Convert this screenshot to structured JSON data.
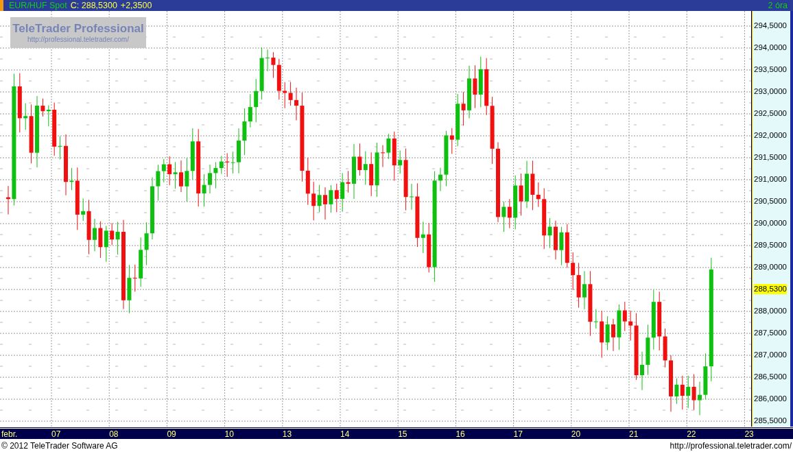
{
  "header": {
    "symbol": "EUR/HUF Spot",
    "close": "C: 288,5300",
    "change": "+2,3500",
    "interval": "2 óra"
  },
  "logo": {
    "title": "TeleTrader Professional",
    "url": "http://professional.teletrader.com/"
  },
  "price_axis": [
    {
      "label": "294,5000",
      "kind": "tick"
    },
    {
      "label": "294,0000",
      "kind": "tick"
    },
    {
      "label": "293,5000",
      "kind": "tick"
    },
    {
      "label": "293,0000",
      "kind": "tick"
    },
    {
      "label": "292,5000",
      "kind": "tick"
    },
    {
      "label": "292,0000",
      "kind": "tick"
    },
    {
      "label": "291,5000",
      "kind": "tick"
    },
    {
      "label": "291,0000",
      "kind": "tick"
    },
    {
      "label": "290,5000",
      "kind": "tick"
    },
    {
      "label": "290,0000",
      "kind": "tick"
    },
    {
      "label": "289,5000",
      "kind": "tick"
    },
    {
      "label": "289,0000",
      "kind": "tick"
    },
    {
      "label": "288,5300",
      "kind": "current"
    },
    {
      "label": "288,0000",
      "kind": "tick"
    },
    {
      "label": "287,5000",
      "kind": "tick"
    },
    {
      "label": "287,0000",
      "kind": "tick"
    },
    {
      "label": "286,5000",
      "kind": "tick"
    },
    {
      "label": "286,0000",
      "kind": "tick"
    },
    {
      "label": "285,5000",
      "kind": "tick"
    }
  ],
  "date_axis": [
    "febr.",
    "07",
    "08",
    "09",
    "10",
    "13",
    "14",
    "15",
    "16",
    "17",
    "20",
    "21",
    "22",
    "23"
  ],
  "footer": {
    "copyright": "© 2012 TeleTrader Software AG",
    "url": "http://professional.teletrader.com/"
  }
}
